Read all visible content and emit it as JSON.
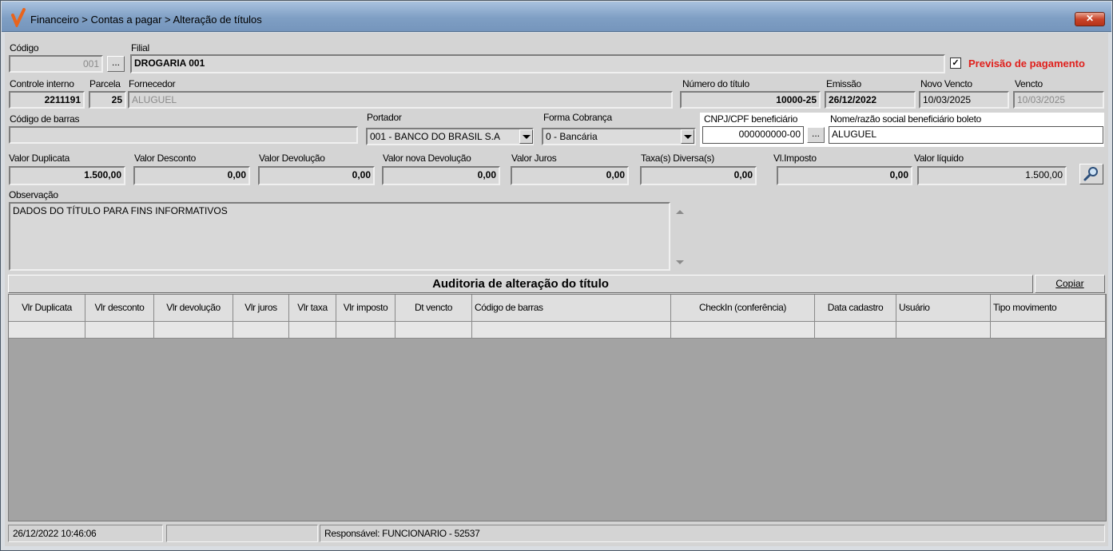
{
  "window": {
    "title": "Financeiro > Contas a pagar > Alteração de títulos",
    "close_label": "✕"
  },
  "form": {
    "codigo_label": "Código",
    "codigo_value": "001",
    "ellipsis": "...",
    "filial_label": "Filial",
    "filial_value": "DROGARIA 001",
    "previsao_checked": "✓",
    "previsao_label": "Previsão de pagamento",
    "controle_label": "Controle interno",
    "controle_value": "2211191",
    "parcela_label": "Parcela",
    "parcela_value": "25",
    "fornecedor_label": "Fornecedor",
    "fornecedor_value": "ALUGUEL",
    "numero_titulo_label": "Número do título",
    "numero_titulo_value": "10000-25",
    "emissao_label": "Emissão",
    "emissao_value": "26/12/2022",
    "novo_vencto_label": "Novo Vencto",
    "novo_vencto_value": "10/03/2025",
    "vencto_label": "Vencto",
    "vencto_value": "10/03/2025",
    "codigo_barras_label": "Código de barras",
    "codigo_barras_value": "",
    "portador_label": "Portador",
    "portador_value": "001 - BANCO DO BRASIL S.A",
    "forma_cobranca_label": "Forma Cobrança",
    "forma_cobranca_value": "0 - Bancária",
    "cnpj_label": "CNPJ/CPF beneficiário",
    "cnpj_value": "000000000-00",
    "nome_benef_label": "Nome/razão social beneficiário boleto",
    "nome_benef_value": "ALUGUEL",
    "valor_duplicata_label": "Valor Duplicata",
    "valor_duplicata_value": "1.500,00",
    "valor_desconto_label": "Valor Desconto",
    "valor_desconto_value": "0,00",
    "valor_devolucao_label": "Valor Devolução",
    "valor_devolucao_value": "0,00",
    "valor_nova_devolucao_label": "Valor nova Devolução",
    "valor_nova_devolucao_value": "0,00",
    "valor_juros_label": "Valor Juros",
    "valor_juros_value": "0,00",
    "taxas_label": "Taxa(s) Diversa(s)",
    "taxas_value": "0,00",
    "vl_imposto_label": "Vl.Imposto",
    "vl_imposto_value": "0,00",
    "valor_liquido_label": "Valor líquido",
    "valor_liquido_value": "1.500,00",
    "observacao_label": "Observação",
    "observacao_value": "DADOS DO TÍTULO PARA FINS INFORMATIVOS"
  },
  "audit": {
    "title": "Auditoria de alteração do título",
    "copy_label": "Copiar",
    "columns": [
      "Vlr Duplicata",
      "Vlr desconto",
      "Vlr devolução",
      "Vlr juros",
      "Vlr taxa",
      "Vlr imposto",
      "Dt vencto",
      "Código de barras",
      "CheckIn (conferência)",
      "Data cadastro",
      "Usuário",
      "Tipo  movimento"
    ]
  },
  "status": {
    "datetime": "26/12/2022 10:46:06",
    "middle": "",
    "responsavel": "Responsável: FUNCIONARIO - 52537"
  },
  "colors": {
    "previsao_text": "#e0201c",
    "logo": "#e8641c"
  },
  "icons": {
    "app": "checkmark-logo-icon",
    "search": "magnifier-icon"
  }
}
